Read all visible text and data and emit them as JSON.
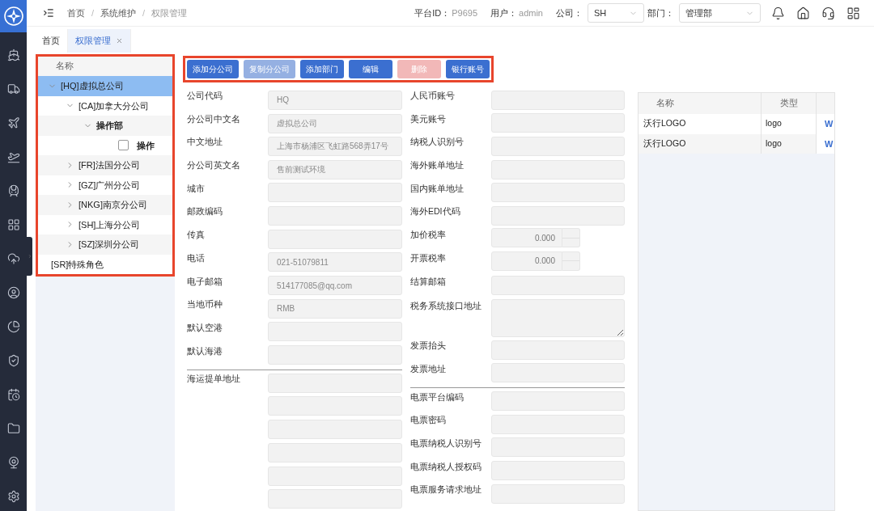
{
  "header": {
    "breadcrumb": [
      "首页",
      "系统维护",
      "权限管理"
    ],
    "separator": "/",
    "platform_label": "平台ID：",
    "platform_id": "P9695",
    "user_label": "用户：",
    "user": "admin",
    "company_label": "公司：",
    "company": "SH",
    "department_label": "部门：",
    "department": "管理部"
  },
  "tabs": [
    {
      "label": "首页",
      "selected": false,
      "closable": false
    },
    {
      "label": "权限管理",
      "selected": true,
      "closable": true
    }
  ],
  "tree": {
    "header": "名称",
    "items": [
      {
        "label": "[HQ]虚拟总公司",
        "kind": "branch",
        "expanded": true,
        "selected": true,
        "children": [
          {
            "label": "[CA]加拿大分公司",
            "kind": "branch",
            "expanded": true,
            "selected": false,
            "children": [
              {
                "label": "操作部",
                "kind": "branch",
                "expanded": true,
                "selected": false,
                "children": [
                  {
                    "label": "操作",
                    "kind": "check",
                    "checked": false,
                    "selected": false
                  }
                ]
              }
            ]
          },
          {
            "label": "[FR]法国分公司",
            "kind": "branch",
            "expanded": false,
            "selected": false
          },
          {
            "label": "[GZ]广州分公司",
            "kind": "branch",
            "expanded": false,
            "selected": false
          },
          {
            "label": "[NKG]南京分公司",
            "kind": "branch",
            "expanded": false,
            "selected": false
          },
          {
            "label": "[SH]上海分公司",
            "kind": "branch",
            "expanded": false,
            "selected": false
          },
          {
            "label": "[SZ]深圳分公司",
            "kind": "branch",
            "expanded": false,
            "selected": false
          }
        ]
      },
      {
        "label": "[SR]特殊角色",
        "kind": "plain",
        "selected": false
      }
    ]
  },
  "toolbar": [
    {
      "label": "添加分公司",
      "kind": "primary",
      "disabled": false
    },
    {
      "label": "复制分公司",
      "kind": "primary",
      "disabled": true
    },
    {
      "label": "添加部门",
      "kind": "primary",
      "disabled": false
    },
    {
      "label": "编辑",
      "kind": "primary",
      "disabled": false
    },
    {
      "label": "删除",
      "kind": "danger",
      "disabled": true
    },
    {
      "label": "银行账号",
      "kind": "primary",
      "disabled": false
    }
  ],
  "form_left": [
    {
      "kind": "text",
      "label": "公司代码",
      "value": "HQ"
    },
    {
      "kind": "text",
      "label": "分公司中文名",
      "value": "虚拟总公司"
    },
    {
      "kind": "text",
      "label": "中文地址",
      "value": "上海市杨浦区飞虹路568弄17号"
    },
    {
      "kind": "text",
      "label": "分公司英文名",
      "value": "售前测试环境"
    },
    {
      "kind": "text",
      "label": "城市"
    },
    {
      "kind": "text",
      "label": "邮政编码"
    },
    {
      "kind": "text",
      "label": "传真"
    },
    {
      "kind": "text",
      "label": "电话",
      "value": "021-51079811"
    },
    {
      "kind": "text",
      "label": "电子邮箱",
      "value": "514177085@qq.com"
    },
    {
      "kind": "text",
      "label": "当地币种",
      "value": "RMB"
    },
    {
      "kind": "text",
      "label": "默认空港"
    },
    {
      "kind": "text",
      "label": "默认海港"
    },
    {
      "kind": "divider"
    },
    {
      "kind": "text",
      "label": "海运提单地址"
    },
    {
      "kind": "text"
    },
    {
      "kind": "text"
    },
    {
      "kind": "text"
    },
    {
      "kind": "text"
    },
    {
      "kind": "text"
    }
  ],
  "form_right": [
    {
      "kind": "text",
      "label": "人民币账号"
    },
    {
      "kind": "text",
      "label": "美元账号"
    },
    {
      "kind": "text",
      "label": "纳税人识别号"
    },
    {
      "kind": "text",
      "label": "海外账单地址"
    },
    {
      "kind": "text",
      "label": "国内账单地址"
    },
    {
      "kind": "text",
      "label": "海外EDI代码"
    },
    {
      "kind": "number",
      "label": "加价税率",
      "value": "0.000"
    },
    {
      "kind": "number",
      "label": "开票税率",
      "value": "0.000"
    },
    {
      "kind": "text",
      "label": "结算邮箱"
    },
    {
      "kind": "textarea",
      "label": "税务系统接口地址"
    },
    {
      "kind": "text",
      "label": "发票抬头"
    },
    {
      "kind": "text",
      "label": "发票地址"
    },
    {
      "kind": "divider"
    },
    {
      "kind": "text",
      "label": "电票平台编码"
    },
    {
      "kind": "text",
      "label": "电票密码"
    },
    {
      "kind": "text",
      "label": "电票纳税人识别号"
    },
    {
      "kind": "text",
      "label": "电票纳税人授权码"
    },
    {
      "kind": "text",
      "label": "电票服务请求地址"
    }
  ],
  "table": {
    "columns": [
      "名称",
      "类型"
    ],
    "rows": [
      {
        "name": "沃行LOGO",
        "type": "logo",
        "column_3": "W"
      },
      {
        "name": "沃行LOGO",
        "type": "logo",
        "column_3": "W"
      }
    ]
  }
}
